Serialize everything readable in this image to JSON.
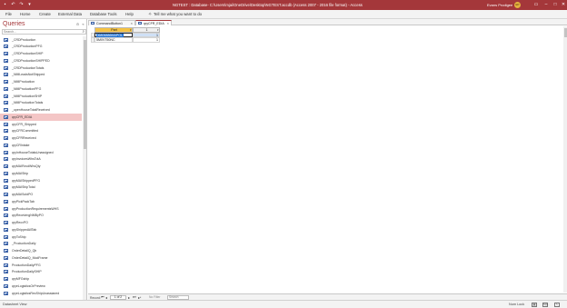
{
  "titlebar": {
    "title": "NGTEST : Database- C:\\Users\\mjai\\OneDrive\\Desktop\\NGTEST.accdb (Access 2007 - 2016 file format) - Access",
    "user": "Evans Prodigee",
    "user_initials": "EP",
    "bg_color": "#a4373a"
  },
  "menu": {
    "items": [
      "File",
      "Home",
      "Create",
      "External Data",
      "Database Tools",
      "Help"
    ],
    "tell_me": "Tell me what you want to do"
  },
  "nav": {
    "header": "Queries",
    "search_placeholder": "Search...",
    "items": [
      "_CRDProduction",
      "_CRDProductionPFG",
      "_CRDProductionSHIP",
      "_CRDProductionSHIPPED",
      "_CRDProductionTotals",
      "_NMILeadsNotShipped",
      "_NMIProduction",
      "_NMIProductionPFG",
      "_NMIProductionSHIP",
      "_NMIProductionTotals",
      "_openHouseTotalReceived",
      "qryCFR_EDIA",
      "qryCFR_Shipped",
      "qryCFRCommitted",
      "qryCFRReceived",
      "qryCRIntake",
      "qryInHouseTotalsUnassigned",
      "qryInvoicesWhsTotA",
      "qryMAIRcvdWhsQty",
      "qryMAIShip",
      "qryMAIShippedPFG",
      "qryMAIShipTotal",
      "qryMAISoldPO",
      "qryPickPackTab",
      "qryProductionRequirementsWHS",
      "qryReceivingNMByPO",
      "qryRecvPO",
      "qryShippedAllTab",
      "qryToShip",
      "_ProductionDaily",
      "OrderDetailQ_Qb",
      "OrderDetailQ_ModFrame",
      "ProductionDailyPFG",
      "ProductionDailySHIP",
      "qryMFGship",
      "qryeLogisticsOrPreview",
      "qryeLogisticsRecShipUnassianed"
    ],
    "selected_index": 11
  },
  "doc_tabs": [
    {
      "label": "CommandButton1",
      "active": false
    },
    {
      "label": "qryCFR_EDIA",
      "active": true
    }
  ],
  "datasheet": {
    "columns": [
      "Part",
      "1"
    ],
    "rows": [
      {
        "part": "06806886MAPOL",
        "value": "1",
        "active": true
      },
      {
        "part": "5M0V750NC",
        "value": "1",
        "active": false
      }
    ]
  },
  "record_nav": {
    "record_label": "Record:",
    "position": "1 of 2",
    "no_filter": "No Filter",
    "search": "Search"
  },
  "status": {
    "left": "Datasheet View",
    "num_lock": "Num Lock"
  }
}
